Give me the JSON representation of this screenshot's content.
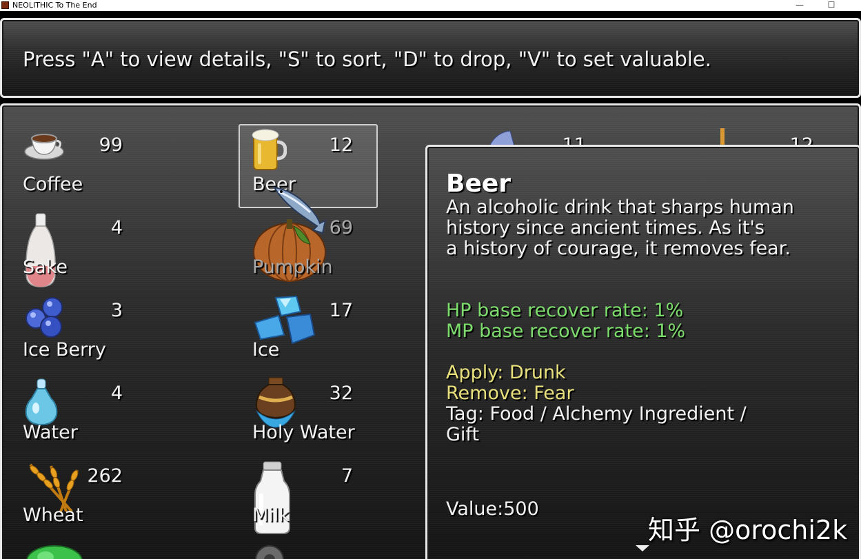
{
  "window": {
    "title": "NEOLITHIC To The End",
    "minimize_glyph": "—",
    "maximize_glyph": "☐"
  },
  "help": {
    "text": "Press \"A\" to view details, \"S\" to sort, \"D\" to drop, \"V\" to set valuable."
  },
  "items": {
    "coffee": {
      "name": "Coffee",
      "qty": "99",
      "icon": "coffee-cup-icon"
    },
    "beer": {
      "name": "Beer",
      "qty": "12",
      "icon": "beer-mug-icon",
      "selected": true
    },
    "sake": {
      "name": "Sake",
      "qty": "4",
      "icon": "sake-bottle-icon"
    },
    "pumpkin": {
      "name": "Pumpkin",
      "qty": "69",
      "icon": "pumpkin-icon",
      "disabled": true
    },
    "ice_berry": {
      "name": "Ice Berry",
      "qty": "3",
      "icon": "ice-berry-icon"
    },
    "ice": {
      "name": "Ice",
      "qty": "17",
      "icon": "ice-crystal-icon"
    },
    "water": {
      "name": "Water",
      "qty": "4",
      "icon": "water-flask-icon"
    },
    "holy_water": {
      "name": "Holy Water",
      "qty": "32",
      "icon": "holy-water-icon"
    },
    "wheat": {
      "name": "Wheat",
      "qty": "262",
      "icon": "wheat-icon"
    },
    "milk": {
      "name": "Milk",
      "qty": "7",
      "icon": "milk-bottle-icon"
    }
  },
  "detail": {
    "title": "Beer",
    "description": [
      "An alcoholic drink that sharps human",
      "history since ancient times. As it's",
      "a history of courage, it removes fear."
    ],
    "hp_rate": "HP base recover rate: 1%",
    "mp_rate": "MP base recover rate: 1%",
    "apply": "Apply: Drunk",
    "remove": "Remove: Fear",
    "tag_line1": "Tag: Food / Alchemy Ingredient /",
    "tag_line2": "Gift",
    "value": "Value:500"
  },
  "watermark": "知乎 @orochi2k",
  "colors": {
    "window_border": "#e8e8e8",
    "stat_green": "#7cdc6c",
    "state_yellow": "#e8e07c",
    "text": "#f2f2f2"
  }
}
